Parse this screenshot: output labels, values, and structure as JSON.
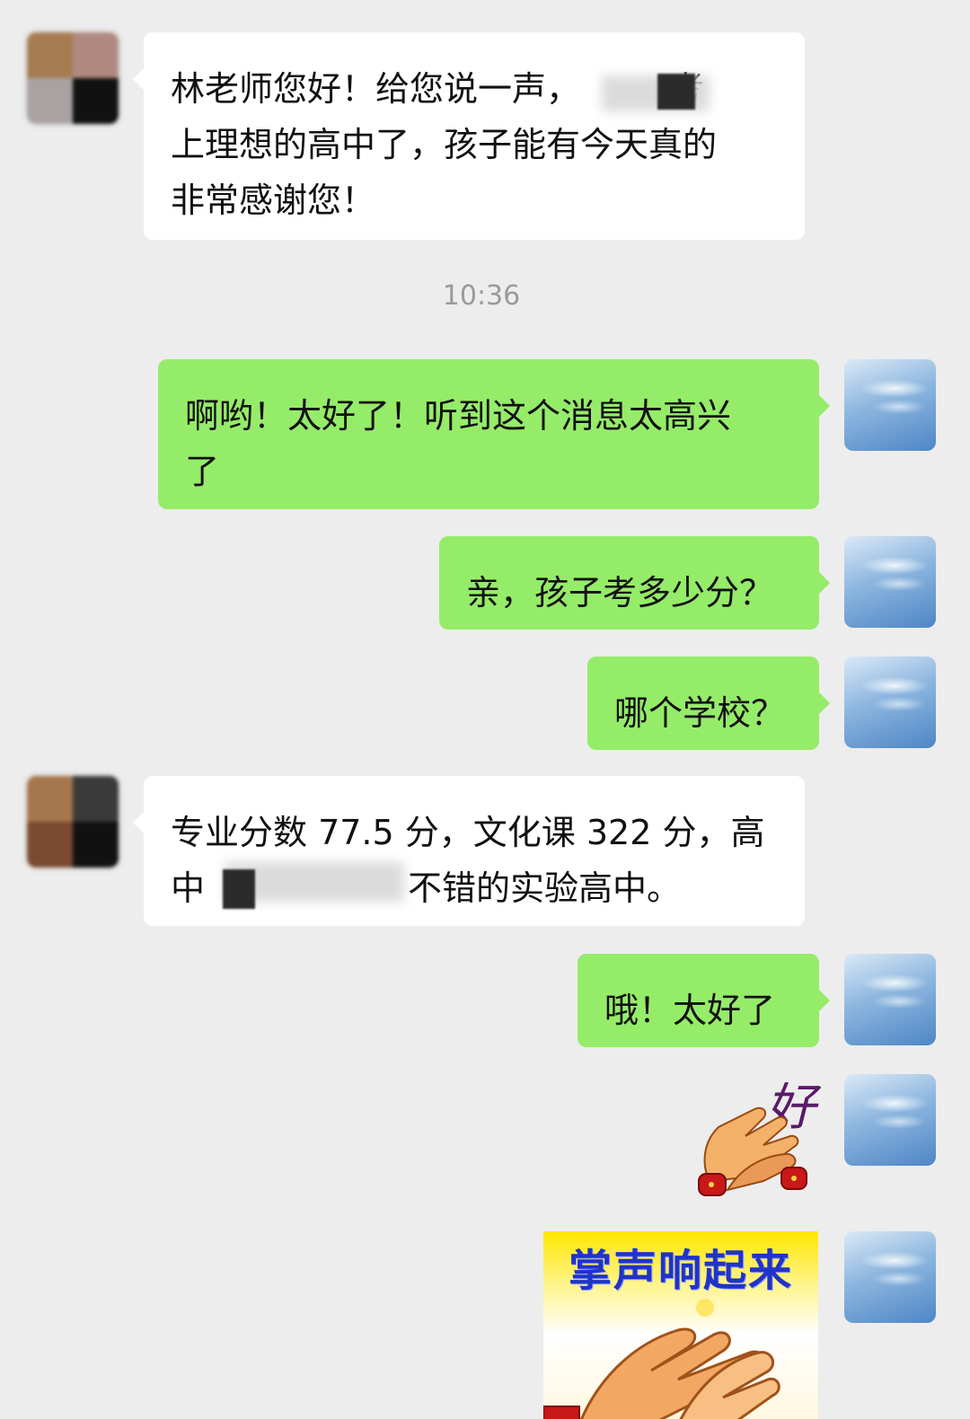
{
  "messages": [
    {
      "sender": "contact",
      "lines": [
        "林老师您好！给您说一声，",
        "考",
        "上理想的高中了，孩子能有今天真的",
        "非常感谢您！"
      ]
    },
    {
      "sender": "me",
      "lines": [
        "啊哟！太好了！听到这个消息太高兴",
        "了"
      ]
    },
    {
      "sender": "me",
      "lines": [
        "亲，孩子考多少分？"
      ]
    },
    {
      "sender": "me",
      "lines": [
        "哪个学校？"
      ]
    },
    {
      "sender": "contact",
      "lines": [
        "专业分数 77.5 分，文化课 322 分，高",
        "中",
        "不错的实验高中。"
      ]
    },
    {
      "sender": "me",
      "lines": [
        "哦！太好了"
      ]
    }
  ],
  "timestamp": "10:36",
  "stickers": {
    "clapping_hands_text": "好",
    "applause_banner_text": "掌声响起来"
  },
  "avatars": {
    "contact_icon": "blurred-photo-icon",
    "me_icon": "sky-cloud-icon"
  },
  "colors": {
    "background": "#ededed",
    "incoming_bubble": "#ffffff",
    "outgoing_bubble": "#95ec69",
    "timestamp_text": "#9a9a9a"
  }
}
